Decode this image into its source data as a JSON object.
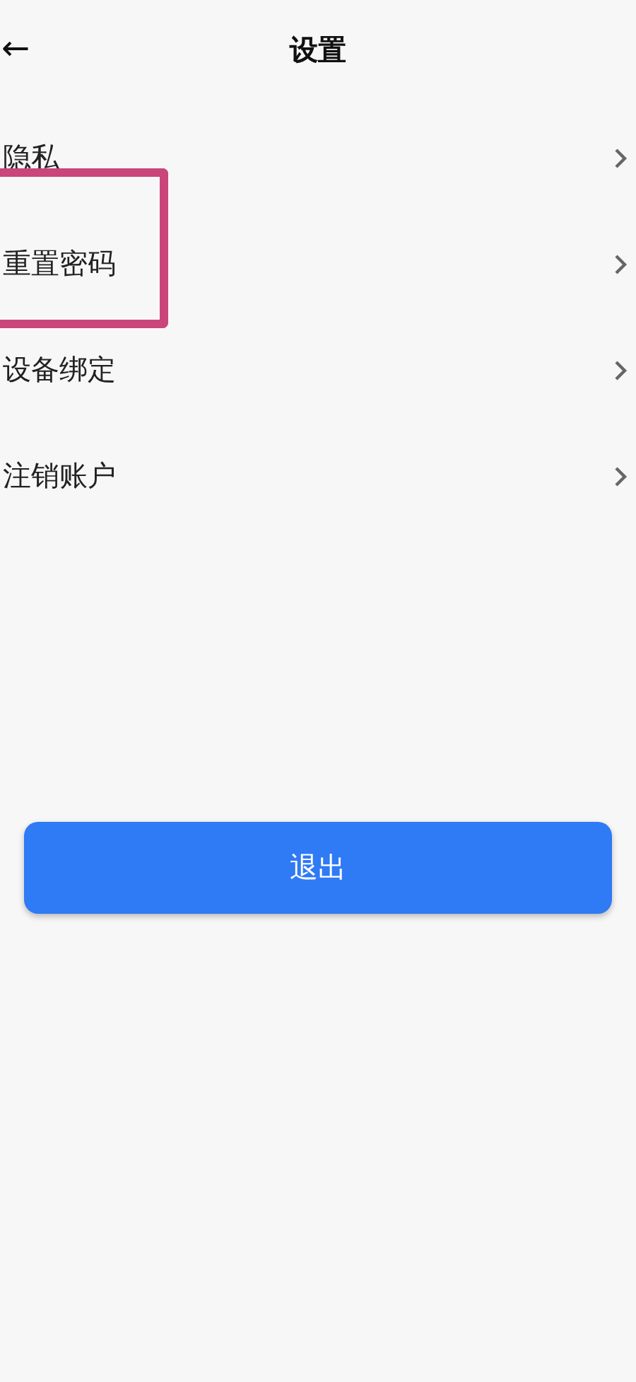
{
  "header": {
    "back": "←",
    "title": "设置"
  },
  "items": [
    {
      "label": "隐私",
      "highlighted": false
    },
    {
      "label": "重置密码",
      "highlighted": true
    },
    {
      "label": "设备绑定",
      "highlighted": false
    },
    {
      "label": "注销账户",
      "highlighted": false
    }
  ],
  "logout_button": "退出"
}
